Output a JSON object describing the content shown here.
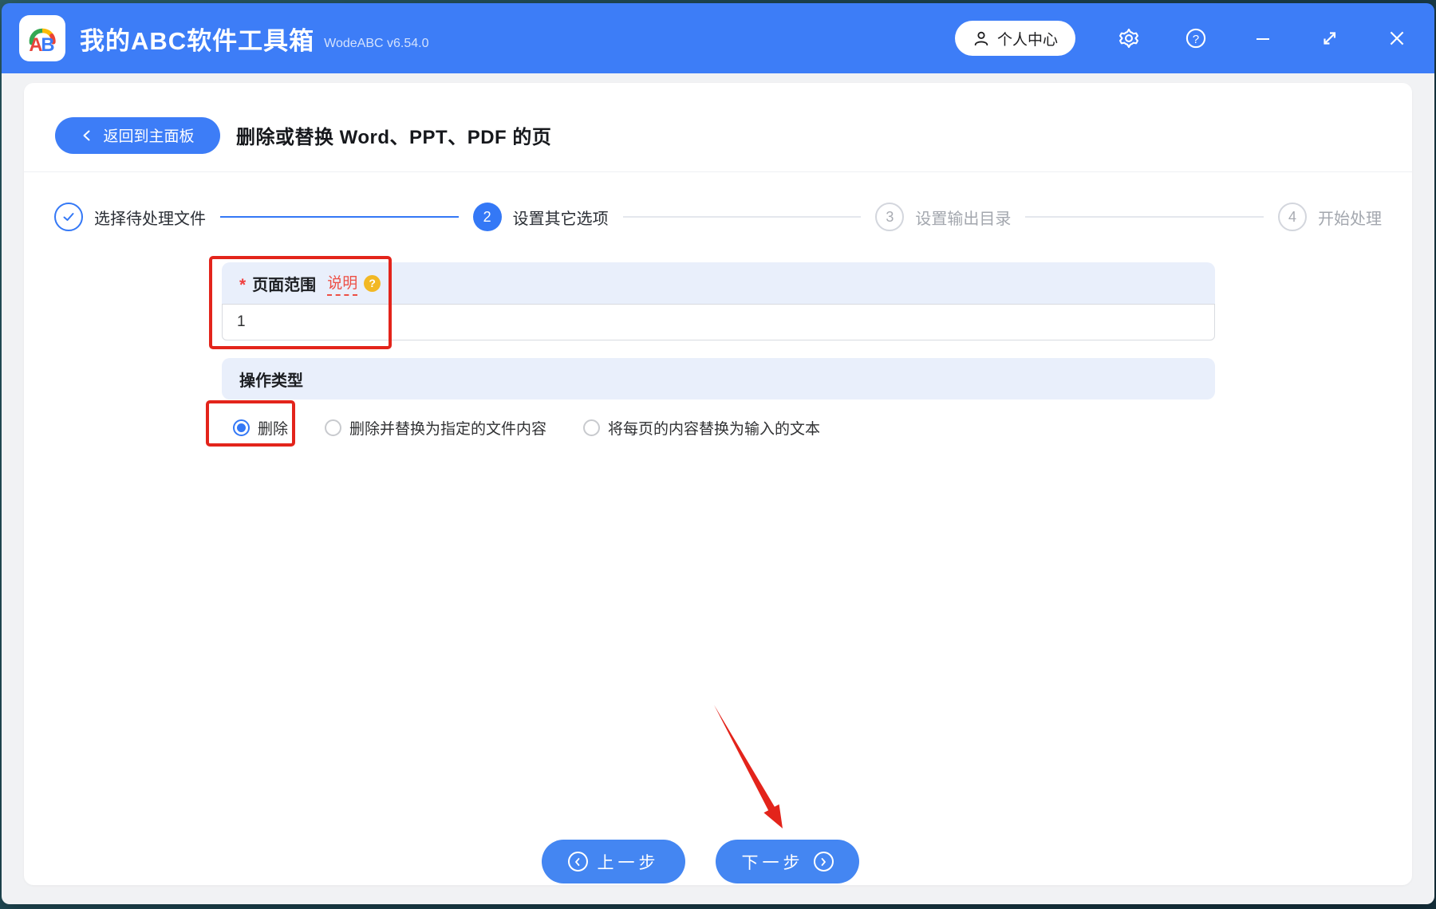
{
  "window": {
    "logo_text_a": "A",
    "logo_text_b": "B",
    "title": "我的ABC软件工具箱",
    "version": "WodeABC v6.54.0",
    "user_center_label": "个人中心"
  },
  "page": {
    "back_label": "返回到主面板",
    "title": "删除或替换 Word、PPT、PDF 的页"
  },
  "stepper": {
    "items": [
      {
        "num": "1",
        "label": "选择待处理文件",
        "state": "done"
      },
      {
        "num": "2",
        "label": "设置其它选项",
        "state": "active"
      },
      {
        "num": "3",
        "label": "设置输出目录",
        "state": "pending"
      },
      {
        "num": "4",
        "label": "开始处理",
        "state": "pending"
      }
    ]
  },
  "form": {
    "page_range": {
      "required_mark": "*",
      "label": "页面范围",
      "help_link": "说明",
      "help_icon": "?",
      "value": "1"
    },
    "operation_type": {
      "label": "操作类型",
      "options": [
        {
          "label": "删除",
          "selected": true
        },
        {
          "label": "删除并替换为指定的文件内容",
          "selected": false
        },
        {
          "label": "将每页的内容替换为输入的文本",
          "selected": false
        }
      ]
    }
  },
  "footer": {
    "prev_label": "上一步",
    "next_label": "下一步"
  },
  "colors": {
    "titlebar_blue": "#3D7DF7",
    "step_blue": "#3478F6",
    "button_blue": "#4486F2",
    "section_header_bg": "#E9EFFB",
    "annotation_red": "#E3241B",
    "help_badge_orange": "#F2B824",
    "help_link_red": "#ED4F45"
  }
}
